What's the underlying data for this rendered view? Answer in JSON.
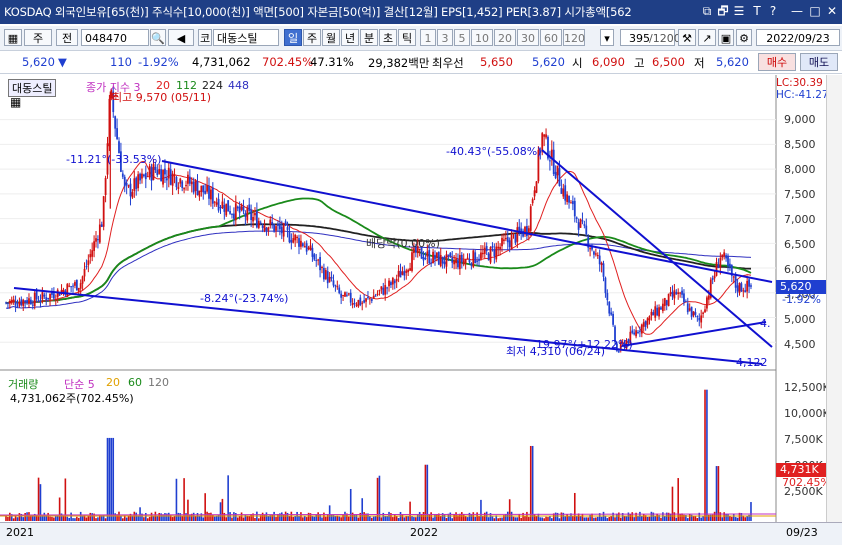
{
  "titlebar": {
    "text": "KOSDAQ 외국인보유[65(천)] 주식수[10,000(천)] 액면[500] 자본금[50(억)] 결산[12월] EPS[1,452] PER[3.87] 시가총액[562",
    "buttons": [
      "⧉",
      "🗗",
      "☰",
      "T",
      "?",
      "—",
      "□",
      "✕"
    ]
  },
  "toolbar": {
    "market_sel": "주",
    "prev_btn": "전",
    "code": "048470",
    "name_prefix": "코",
    "name": "대동스틸",
    "periods": [
      "일",
      "주",
      "월",
      "년",
      "분",
      "초",
      "틱"
    ],
    "active_period": "일",
    "intervals": [
      "1",
      "3",
      "5",
      "10",
      "20",
      "30",
      "60",
      "120"
    ],
    "count": "395",
    "count_total": "/1200",
    "date": "2022/09/23"
  },
  "quote": {
    "price": "5,620",
    "arrow": "▼",
    "change": "110",
    "change_pct": "-1.92%",
    "volume": "4,731,062",
    "vol_ratio": "702.45%",
    "turnover": "47.31%",
    "amount": "29,382백만",
    "pref_label": "최우선",
    "bid1": "5,650",
    "bid2": "5,620",
    "open_label": "시",
    "open": "6,090",
    "high_label": "고",
    "high": "6,500",
    "low_label": "저",
    "low": "5,620",
    "buy_btn": "매수",
    "sell_btn": "매도"
  },
  "price_panel": {
    "name_tab": "대동스틸",
    "legend": {
      "main": "종가 지수 3",
      "ma20": "20",
      "ma112": "112",
      "ma224": "224",
      "ma448": "448"
    },
    "lc": "LC:30.39",
    "hc": "HC:-41.27",
    "high_note": "최고 9,570 (05/11)",
    "low_note": "최저 4,310 (06/24)",
    "ann1": "-11.21°(-33.53%)",
    "ann2": "-40.43°(-55.08%)",
    "ann3": "-8.24°(-23.74%)",
    "ann4": "배당락(0.00%)",
    "ann5": "19.97°(+12.22%)",
    "ann6": "4,122",
    "ann7": "4.",
    "y_ticks": [
      "9,000",
      "8,500",
      "8,000",
      "7,500",
      "7,000",
      "6,500",
      "6,000",
      "5,500",
      "5,000",
      "4,500"
    ],
    "price_box": "5,620",
    "price_pct": "-1.92%"
  },
  "volume_panel": {
    "title": "거래량",
    "legend": {
      "simple": "단순 5",
      "m20": "20",
      "m60": "60",
      "m120": "120"
    },
    "value": "4,731,062주(702.45%)",
    "y_ticks": [
      "12,500K",
      "10,000K",
      "7,500K",
      "5,000K",
      "2,500K"
    ],
    "vol_box": "4,731K",
    "vol_pct": "702.45%"
  },
  "x_axis": {
    "labels": [
      "2021",
      "2022",
      "09/23"
    ]
  },
  "colors": {
    "title_bg": "#1f3f86",
    "up": "#d01010",
    "down": "#1f3fd0",
    "ma20": "#e02020",
    "ma112": "#1a8a1a",
    "ma224": "#222222",
    "ma448": "#3030c0",
    "trend": "#1010d0"
  },
  "chart_data": {
    "type": "candlestick",
    "series": [
      {
        "name": "종가",
        "points": [
          [
            0,
            5300
          ],
          [
            0.05,
            5400
          ],
          [
            0.1,
            5700
          ],
          [
            0.13,
            7000
          ],
          [
            0.14,
            9570
          ],
          [
            0.16,
            7500
          ],
          [
            0.2,
            8000
          ],
          [
            0.25,
            7700
          ],
          [
            0.3,
            7200
          ],
          [
            0.35,
            6900
          ],
          [
            0.4,
            6500
          ],
          [
            0.45,
            5400
          ],
          [
            0.48,
            5300
          ],
          [
            0.52,
            5700
          ],
          [
            0.55,
            6300
          ],
          [
            0.6,
            6100
          ],
          [
            0.65,
            6300
          ],
          [
            0.7,
            6800
          ],
          [
            0.72,
            8700
          ],
          [
            0.75,
            7500
          ],
          [
            0.8,
            6000
          ],
          [
            0.82,
            4310
          ],
          [
            0.85,
            4800
          ],
          [
            0.9,
            5500
          ],
          [
            0.93,
            4900
          ],
          [
            0.96,
            6300
          ],
          [
            0.98,
            5620
          ]
        ]
      }
    ],
    "ylim": [
      4122,
      9570
    ]
  }
}
